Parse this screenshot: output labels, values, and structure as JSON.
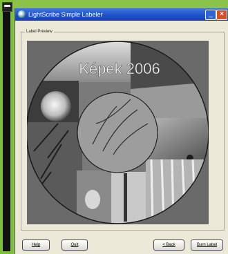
{
  "window": {
    "title": "LightScribe Simple Labeler",
    "minimize_glyph": "_",
    "close_glyph": "×"
  },
  "preview_group": {
    "label": "Label Preview",
    "disc_title": "Képek 2006"
  },
  "buttons": {
    "help": "Help",
    "quit": "Quit",
    "back": "< Back",
    "burn": "Burn Label"
  }
}
